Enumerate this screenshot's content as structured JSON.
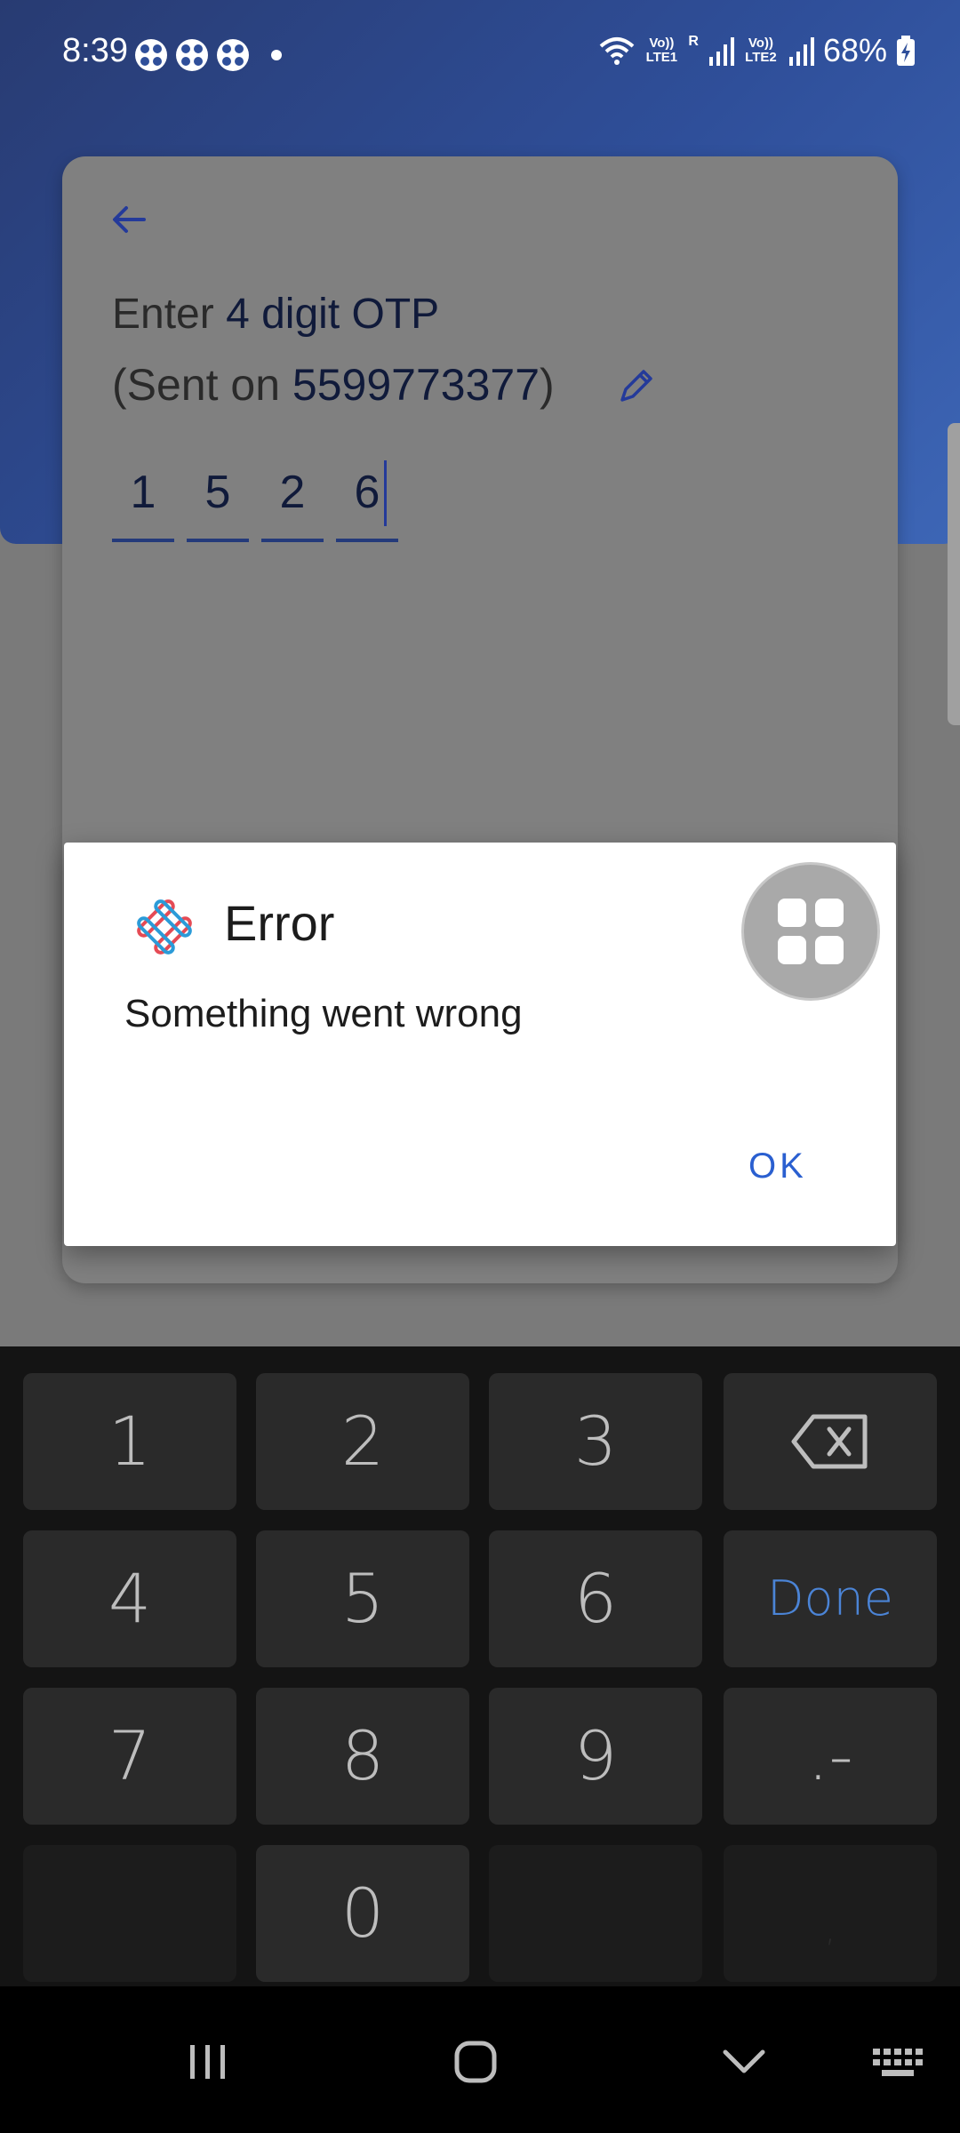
{
  "status_bar": {
    "time": "8:39",
    "notifications": [
      "notification-icon",
      "notification-icon",
      "notification-icon"
    ],
    "network1": "Vo)) LTE1",
    "roaming": "R",
    "network2": "Vo)) LTE2",
    "battery": "68%"
  },
  "otp": {
    "title_prefix": "Enter",
    "title_main": "4 digit OTP",
    "sent_prefix": "(Sent on",
    "phone": "5599773377",
    "sent_suffix": ")",
    "digits": [
      "1",
      "5",
      "2",
      "6"
    ]
  },
  "dialog": {
    "title": "Error",
    "message": "Something went wrong",
    "ok_label": "OK"
  },
  "keyboard": {
    "row1": [
      "1",
      "2",
      "3"
    ],
    "row2": [
      "4",
      "5",
      "6"
    ],
    "done_label": "Done",
    "row3": [
      "7",
      "8",
      "9"
    ],
    "symbol_key": ".-",
    "zero": "0",
    "comma": ","
  },
  "colors": {
    "header_blue": "#2f4f9a",
    "accent_blue": "#2a5fd0",
    "keyboard_bg": "#141414"
  }
}
